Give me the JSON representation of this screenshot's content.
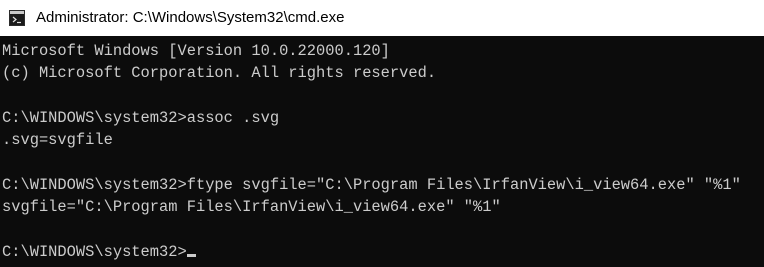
{
  "window": {
    "title": "Administrator: C:\\Windows\\System32\\cmd.exe",
    "icon": "cmd-icon"
  },
  "console": {
    "lines": [
      "Microsoft Windows [Version 10.0.22000.120]",
      "(c) Microsoft Corporation. All rights reserved.",
      "",
      "C:\\WINDOWS\\system32>assoc .svg",
      ".svg=svgfile",
      "",
      "C:\\WINDOWS\\system32>ftype svgfile=\"C:\\Program Files\\IrfanView\\i_view64.exe\" \"%1\"",
      "svgfile=\"C:\\Program Files\\IrfanView\\i_view64.exe\" \"%1\"",
      "",
      "C:\\WINDOWS\\system32>"
    ]
  },
  "colors": {
    "background": "#0c0c0c",
    "text": "#cccccc",
    "titlebar": "#ffffff"
  }
}
